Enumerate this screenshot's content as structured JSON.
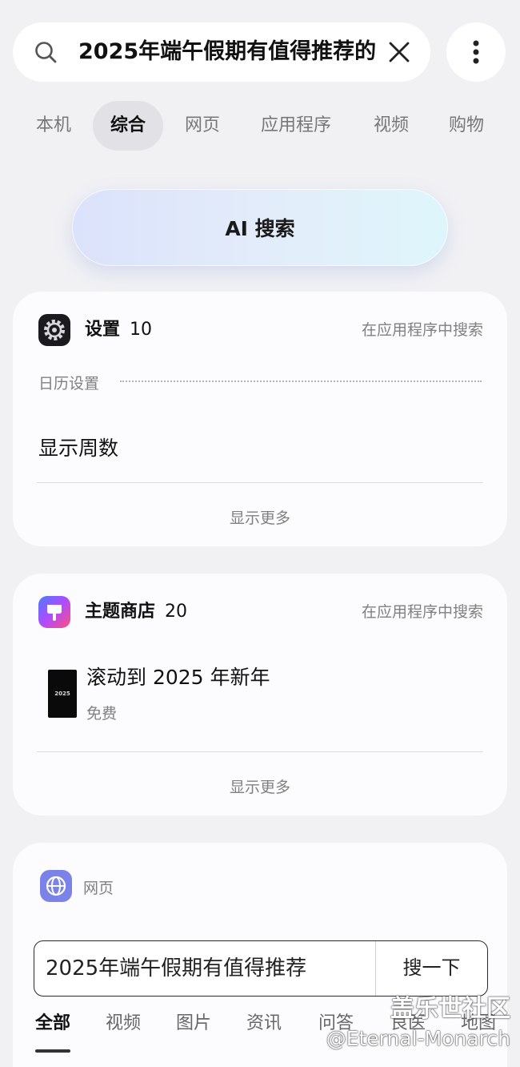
{
  "search": {
    "query": "2025年端午假期有值得推荐的"
  },
  "tabs": [
    "本机",
    "综合",
    "网页",
    "应用程序",
    "视频",
    "购物"
  ],
  "ai_search_label": "AI 搜索",
  "settings_card": {
    "app_name": "设置",
    "count": "10",
    "search_in_app": "在应用程序中搜索",
    "section": "日历设置",
    "item": "显示周数",
    "show_more": "显示更多"
  },
  "theme_card": {
    "app_name": "主题商店",
    "count": "20",
    "search_in_app": "在应用程序中搜索",
    "item_title": "滚动到 2025 年新年",
    "item_price": "免费",
    "thumb_text": "2025",
    "show_more": "显示更多"
  },
  "web": {
    "label": "网页",
    "query": "2025年端午假期有值得推荐",
    "search_button": "搜一下",
    "tabs": [
      "全部",
      "视频",
      "图片",
      "资讯",
      "问答",
      "良医",
      "地图"
    ]
  },
  "watermark": {
    "line1": "盖乐世社区",
    "line2": "@Eternal-Monarch"
  },
  "colors": {
    "background": "#f1f1f4",
    "card": "#fcfcfe",
    "muted_text": "#808080",
    "ai_gradient_start": "#dbe2fb",
    "ai_gradient_end": "#def6fb"
  }
}
